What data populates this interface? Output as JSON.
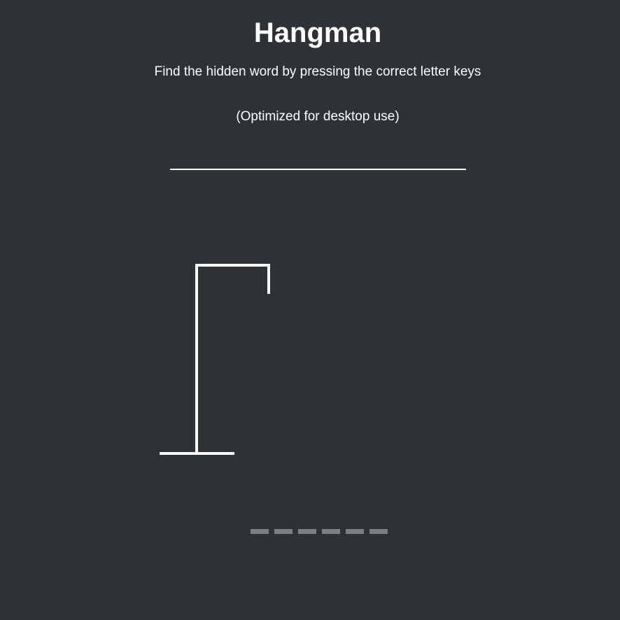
{
  "game": {
    "title": "Hangman",
    "instructions": "Find the hidden word by pressing the correct letter keys",
    "note": "(Optimized for desktop use)"
  },
  "colors": {
    "background": "#2e3236",
    "foreground": "#ffffff",
    "slot": "#7d8184"
  },
  "hangman": {
    "wrong_guesses": 0,
    "parts_visible": [
      "base",
      "pole",
      "beam",
      "rope"
    ]
  },
  "word": {
    "length": 6,
    "revealed": [
      "",
      "",
      "",
      "",
      "",
      ""
    ]
  }
}
